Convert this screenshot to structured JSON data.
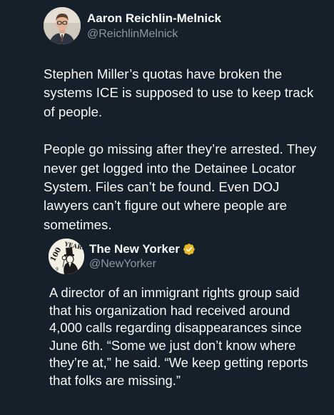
{
  "author": {
    "name": "Aaron Reichlin-Melnick",
    "handle": "@ReichlinMelnick",
    "avatar_icon": "person-avatar"
  },
  "tweet": {
    "paragraphs": [
      "Stephen Miller’s quotas have broken the systems ICE is supposed to use to keep track of people.",
      "People go missing after they’re arrested. They never get logged into the Detainee Locator System. Files can’t be found. Even DOJ lawyers can’t figure out where people are sometimes."
    ]
  },
  "quoted": {
    "name": "The New Yorker",
    "handle": "@NewYorker",
    "verified_badge_color": "#e8b829",
    "avatar_icon": "eustace-tilley-logo",
    "text": "A director of an immigrant rights group said that his organization had received around 4,000 calls regarding disappearances since June 6th. “Some we just don’t know where they’re at,” he said. “We keep getting reports that folks are missing.”"
  },
  "colors": {
    "background": "#15202b",
    "text": "#f7f9f9",
    "secondary_text": "#8b98a5"
  }
}
